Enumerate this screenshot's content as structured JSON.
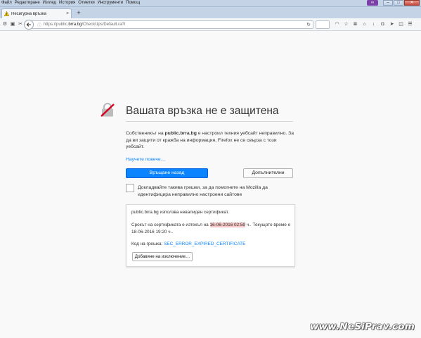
{
  "menu": [
    "Файл",
    "Редактиране",
    "Изглед",
    "История",
    "Отметки",
    "Инструменти",
    "Помощ"
  ],
  "window_controls": {
    "minimize": "–",
    "maximize": "□",
    "close": "✕",
    "extension": "∞"
  },
  "tab": {
    "label": "Несигурна връзка",
    "close": "×",
    "new_tab": "+"
  },
  "nav": {
    "url_prefix": "https://public.",
    "url_host": "brra.bg",
    "url_path": "/CheckUps/Default.ra?l",
    "lock_icon": "ⓘ",
    "reload_icon": "↻"
  },
  "error": {
    "title": "Вашата връзка не е защитена",
    "desc_before": "Собственикът на ",
    "desc_host": "public.brra.bg",
    "desc_after": " е настроил техния уебсайт неправилно. За да ви защити от кражба на информация, Firefox не се свърза с този уебсайт.",
    "learn_more": "Научете повече…",
    "go_back": "Връщане назад",
    "advanced": "Допълнителни",
    "report": "Докладвайте такива грешки, за да помогнете на Mozilla да идентифицира неправилно настроени сайтове"
  },
  "details": {
    "line1": "public.brra.bg използва невалиден сертификат.",
    "line2_before": "Срокът на сертификата е изтекъл на ",
    "line2_expiry": "16-06-2016 02:59",
    "line2_after": " ч.. Текущото време е 18-06-2016 19:20 ч..",
    "code_label": "Код на грешка: ",
    "code_value": "SEC_ERROR_EXPIRED_CERTIFICATE",
    "add_exception": "Добавяне на изключение…"
  },
  "watermark": "www.NeSiPrav.com",
  "colors": {
    "primary": "#0a84ff",
    "highlight": "#f6c6c6",
    "title_bar": "#c4d3e6"
  }
}
